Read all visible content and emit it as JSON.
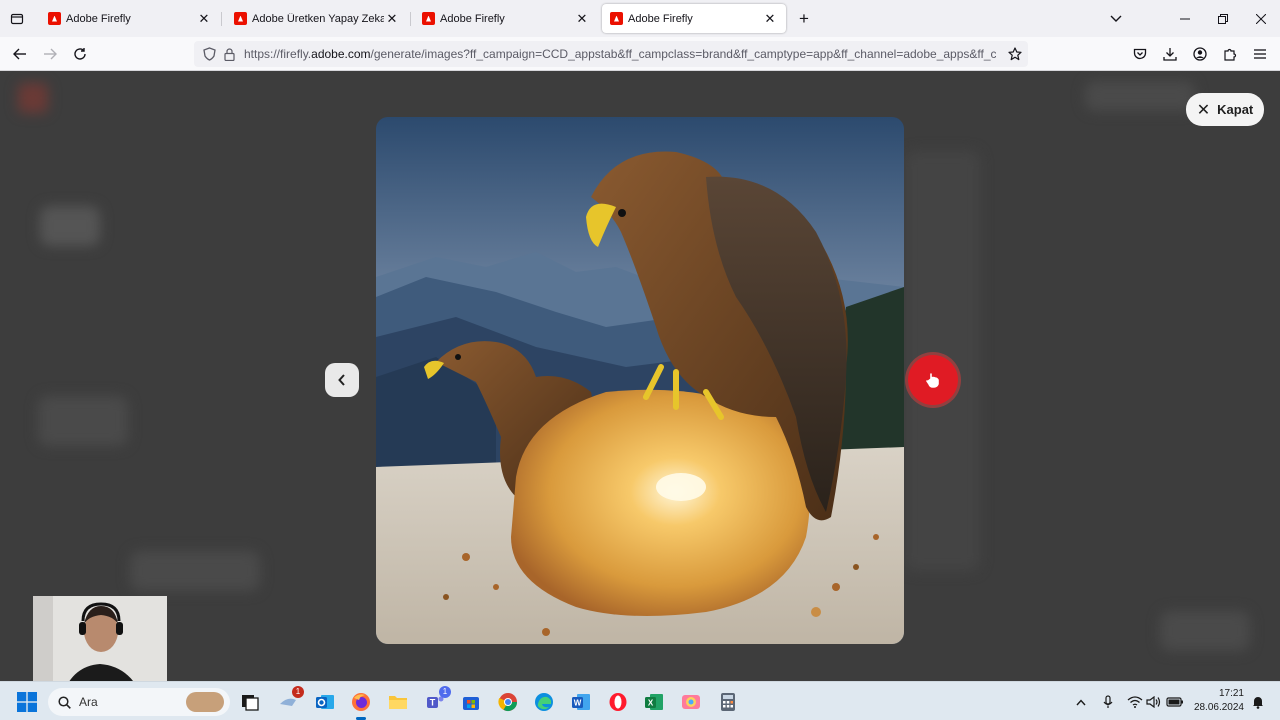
{
  "browser": {
    "tabs": [
      {
        "title": "Adobe Firefly",
        "active": false
      },
      {
        "title": "Adobe Üretken Yapay Zeka Kul",
        "active": false
      },
      {
        "title": "Adobe Firefly",
        "active": false
      },
      {
        "title": "Adobe Firefly",
        "active": true
      }
    ],
    "url": {
      "prefix": "https://firefly.",
      "host": "adobe.com",
      "rest": "/generate/images?ff_campaign=CCD_appstab&ff_campclass=brand&ff_camptype=app&ff_channel=adobe_apps&ff_content"
    },
    "new_tab_symbol": "+"
  },
  "page": {
    "close_label": "Kapat",
    "image_alt": "Two eagles perched on a broken loaf of bread in front of a mountain landscape",
    "accent_color": "#e01b24"
  },
  "taskbar": {
    "search_placeholder": "Ara",
    "badges": {
      "outlook": "1",
      "teams": "1"
    },
    "time": "17:21",
    "date": "28.06.2024"
  }
}
